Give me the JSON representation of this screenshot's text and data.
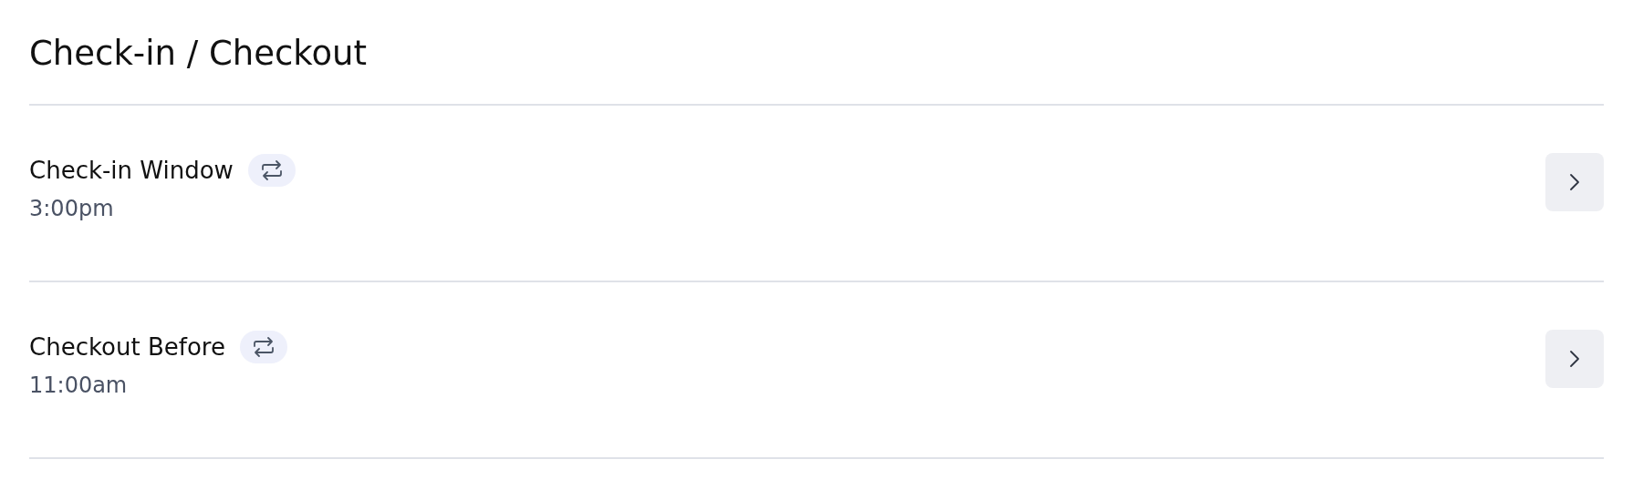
{
  "title": "Check-in / Checkout",
  "settings": [
    {
      "label": "Check-in Window",
      "value": "3:00pm"
    },
    {
      "label": "Checkout Before",
      "value": "11:00am"
    }
  ]
}
